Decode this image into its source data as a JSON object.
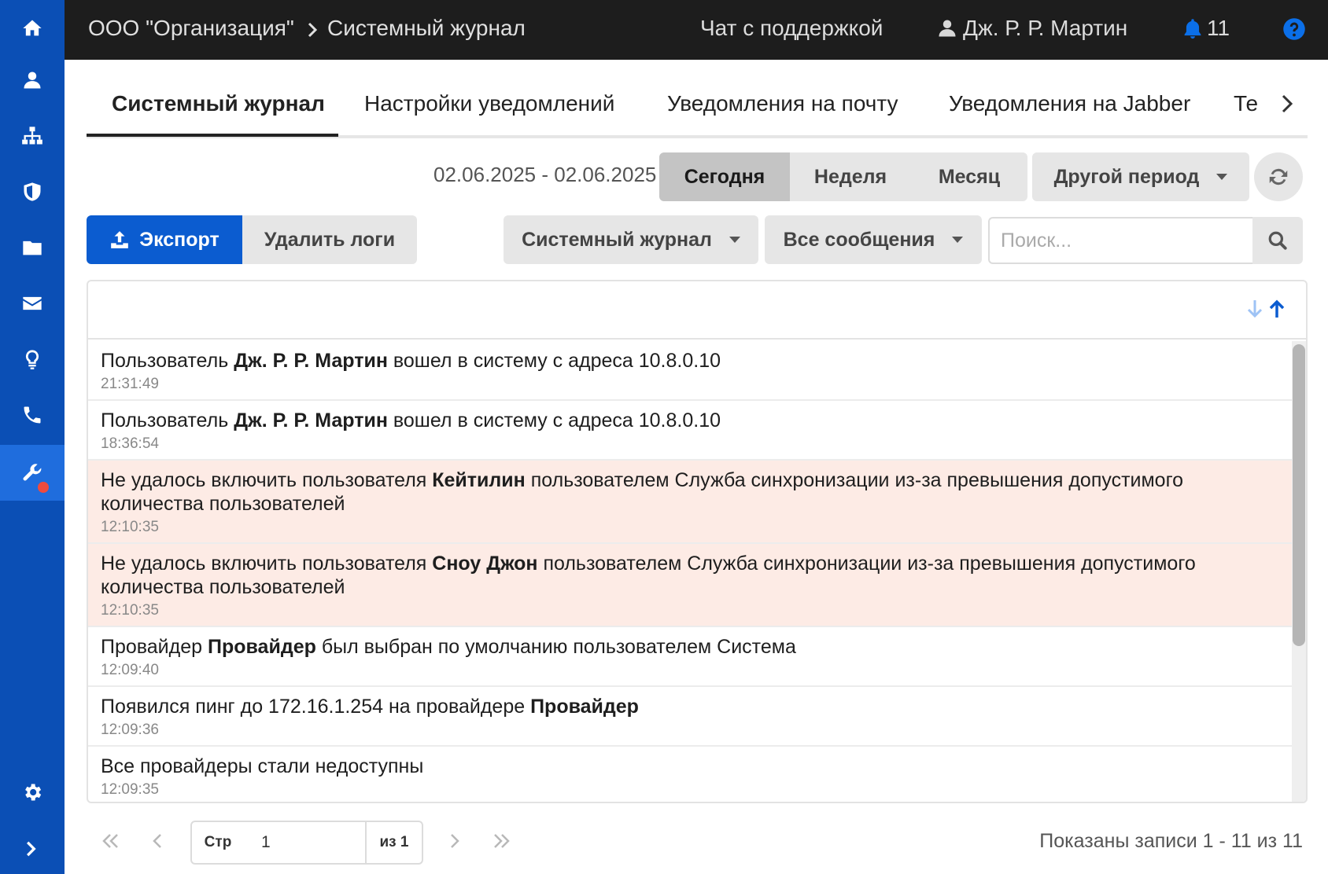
{
  "header": {
    "org": "ООО \"Организация\"",
    "page": "Системный журнал",
    "support_chat": "Чат с поддержкой",
    "user_name": "Дж. Р. Р. Мартин",
    "notifications_count": "11"
  },
  "sidebar": {
    "items": [
      "home-icon",
      "user-icon",
      "sitemap-icon",
      "shield-icon",
      "folder-icon",
      "envelope-icon",
      "lightbulb-icon",
      "phone-icon",
      "wrench-icon"
    ],
    "active": "wrench-icon",
    "bottom": [
      "gear-icon",
      "chevron-right-icon"
    ]
  },
  "tabs": [
    {
      "label": "Системный журнал",
      "active": true
    },
    {
      "label": "Настройки уведомлений"
    },
    {
      "label": "Уведомления на почту"
    },
    {
      "label": "Уведомления на Jabber"
    },
    {
      "label": "Те"
    }
  ],
  "period": {
    "range": "02.06.2025 - 02.06.2025",
    "today": "Сегодня",
    "week": "Неделя",
    "month": "Месяц",
    "other": "Другой период"
  },
  "actions": {
    "export": "Экспорт",
    "delete_logs": "Удалить логи",
    "log_filter": "Системный журнал",
    "message_filter": "Все сообщения",
    "search_placeholder": "Поиск..."
  },
  "logs": [
    {
      "parts": [
        {
          "t": "Пользователь "
        },
        {
          "t": "Дж. Р. Р. Мартин",
          "b": true
        },
        {
          "t": " вошел в систему с адреса 10.8.0.10"
        }
      ],
      "time": "21:31:49",
      "error": false
    },
    {
      "parts": [
        {
          "t": "Пользователь "
        },
        {
          "t": "Дж. Р. Р. Мартин",
          "b": true
        },
        {
          "t": " вошел в систему с адреса 10.8.0.10"
        }
      ],
      "time": "18:36:54",
      "error": false
    },
    {
      "parts": [
        {
          "t": "Не удалось включить пользователя "
        },
        {
          "t": "Кейтилин",
          "b": true
        },
        {
          "t": " пользователем Служба синхронизации из-за превышения допустимого количества пользователей"
        }
      ],
      "time": "12:10:35",
      "error": true
    },
    {
      "parts": [
        {
          "t": "Не удалось включить пользователя "
        },
        {
          "t": "Сноу Джон",
          "b": true
        },
        {
          "t": " пользователем Служба синхронизации из-за превышения допустимого количества пользователей"
        }
      ],
      "time": "12:10:35",
      "error": true
    },
    {
      "parts": [
        {
          "t": "Провайдер "
        },
        {
          "t": "Провайдер",
          "b": true
        },
        {
          "t": " был выбран по умолчанию пользователем Система"
        }
      ],
      "time": "12:09:40",
      "error": false
    },
    {
      "parts": [
        {
          "t": "Появился пинг до 172.16.1.254 на провайдере "
        },
        {
          "t": "Провайдер",
          "b": true
        }
      ],
      "time": "12:09:36",
      "error": false
    },
    {
      "parts": [
        {
          "t": "Все провайдеры стали недоступны"
        }
      ],
      "time": "12:09:35",
      "error": false
    }
  ],
  "pagination": {
    "page_label": "Стр",
    "page_value": "1",
    "of_label": "из 1",
    "summary": "Показаны записи 1 - 11 из 11"
  },
  "colors": {
    "sidebar": "#0b4fb5",
    "sidebar_active": "#1f6ddd",
    "topbar": "#1d1d1d",
    "accent": "#0b5cd0",
    "error_row": "#fdebe5",
    "badge": "#ef4b3f"
  }
}
